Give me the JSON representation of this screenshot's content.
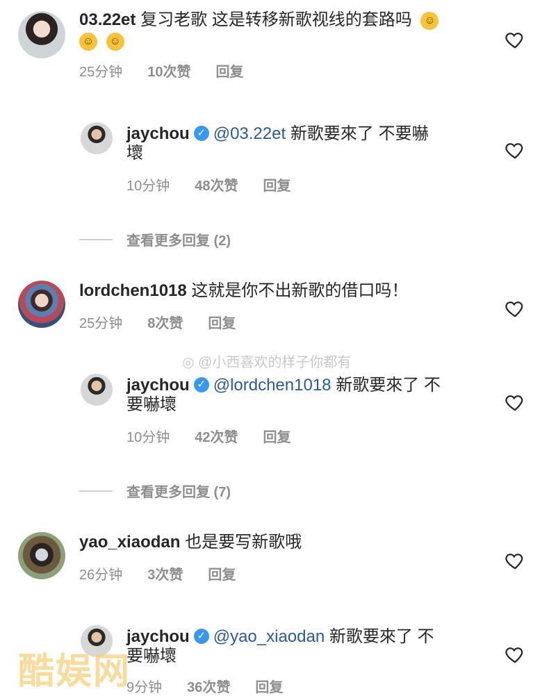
{
  "comments": [
    {
      "user": "03.22et",
      "text": "复习老歌 这是转移新歌视线的套路吗",
      "emoji_count_line1": 1,
      "emoji_count_line2": 2,
      "time": "25分钟",
      "likes": "10次赞",
      "reply": "回复",
      "reply_item": {
        "user": "jaychou",
        "mention": "@03.22et",
        "text_line1": "新歌要來了 不要嚇",
        "text_line2": "壞",
        "time": "10分钟",
        "likes": "48次赞",
        "reply": "回复"
      },
      "more": "查看更多回复 (2)"
    },
    {
      "user": "lordchen1018",
      "text": "这就是你不出新歌的借口吗！",
      "time": "25分钟",
      "likes": "8次赞",
      "reply": "回复",
      "reply_item": {
        "user": "jaychou",
        "mention": "@lordchen1018",
        "text_line1": "新歌要來了 不",
        "text_line2": "要嚇壞",
        "time": "10分钟",
        "likes": "42次赞",
        "reply": "回复"
      },
      "more": "查看更多回复 (7)"
    },
    {
      "user": "yao_xiaodan",
      "text": "也是要写新歌哦",
      "time": "26分钟",
      "likes": "3次赞",
      "reply": "回复",
      "reply_item": {
        "user": "jaychou",
        "mention": "@yao_xiaodan",
        "text_line1": "新歌要來了 不",
        "text_line2": "要嚇壞",
        "time": "9分钟",
        "likes": "36次赞",
        "reply": "回复"
      }
    }
  ],
  "watermark": "@小西喜欢的样子你都有",
  "corner_logo": "酷娱网",
  "icons": {
    "heart": "heart-outline-icon",
    "verified": "verified-badge-icon",
    "emoji": "smiling-cat-emoji-icon",
    "weibo": "weibo-icon"
  },
  "colors": {
    "text": "#262626",
    "meta": "#8e8e8e",
    "mention": "#2a5a9a",
    "verified": "#3897f0",
    "emoji": "#f7c33a"
  }
}
